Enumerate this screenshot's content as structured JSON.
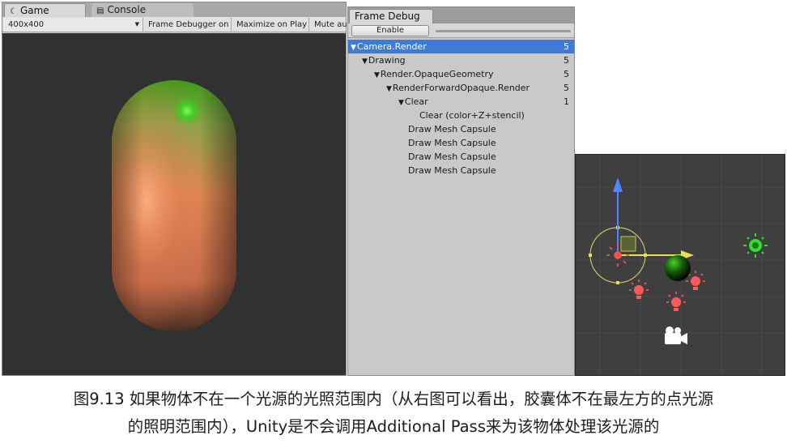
{
  "game": {
    "tab_game": "Game",
    "tab_console": "Console",
    "resolution": "400x400",
    "btn_frame_debugger": "Frame Debugger on",
    "btn_maximize": "Maximize on Play",
    "btn_mute": "Mute aud"
  },
  "frame_debug": {
    "tab": "Frame Debug",
    "enable_label": "Enable",
    "rows": [
      {
        "label": "Camera.Render",
        "count": "5"
      },
      {
        "label": "Drawing",
        "count": "5"
      },
      {
        "label": "Render.OpaqueGeometry",
        "count": "5"
      },
      {
        "label": "RenderForwardOpaque.Render",
        "count": "5"
      },
      {
        "label": "Clear",
        "count": "1"
      },
      {
        "label": "Clear (color+Z+stencil)",
        "count": ""
      },
      {
        "label": "Draw Mesh Capsule",
        "count": ""
      },
      {
        "label": "Draw Mesh Capsule",
        "count": ""
      },
      {
        "label": "Draw Mesh Capsule",
        "count": ""
      },
      {
        "label": "Draw Mesh Capsule",
        "count": ""
      }
    ]
  },
  "caption": {
    "line1": "图9.13 如果物体不在一个光源的光照范围内（从右图可以看出，胶囊体不在最左方的点光源",
    "line2": "的照明范围内），Unity是不会调用Additional Pass来为该物体处理该光源的"
  },
  "colors": {
    "selection": "#3d7bd6",
    "light_red": "#ff5050",
    "light_green": "#33dd33",
    "gizmo_yellow": "#e8e05a"
  }
}
